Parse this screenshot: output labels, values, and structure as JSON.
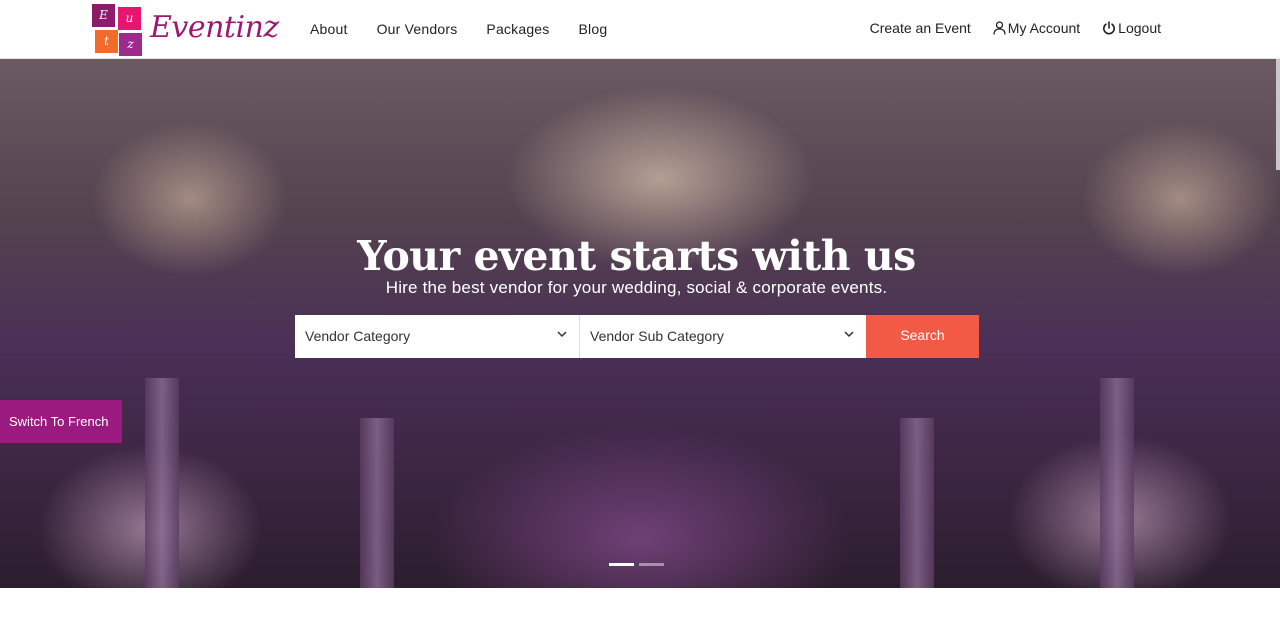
{
  "brand": {
    "name": "Eventinz",
    "logo_letters": [
      "E",
      "u",
      "t",
      "z"
    ]
  },
  "nav": {
    "items": [
      "About",
      "Our Vendors",
      "Packages",
      "Blog"
    ]
  },
  "account_nav": {
    "create_event": "Create an Event",
    "my_account": "My Account",
    "logout": "Logout"
  },
  "hero": {
    "title": "Your event starts with us",
    "subtitle": "Hire the best vendor for your wedding, social & corporate events."
  },
  "search": {
    "category_placeholder": "Vendor Category",
    "subcategory_placeholder": "Vendor Sub Category",
    "button_label": "Search"
  },
  "language_toggle": {
    "label": "Switch To French"
  },
  "carousel": {
    "slide_count": 2,
    "active_slide": 1
  },
  "colors": {
    "brand_purple": "#9b1a6f",
    "search_button": "#f25a45",
    "language_toggle": "#9b1a7f"
  }
}
